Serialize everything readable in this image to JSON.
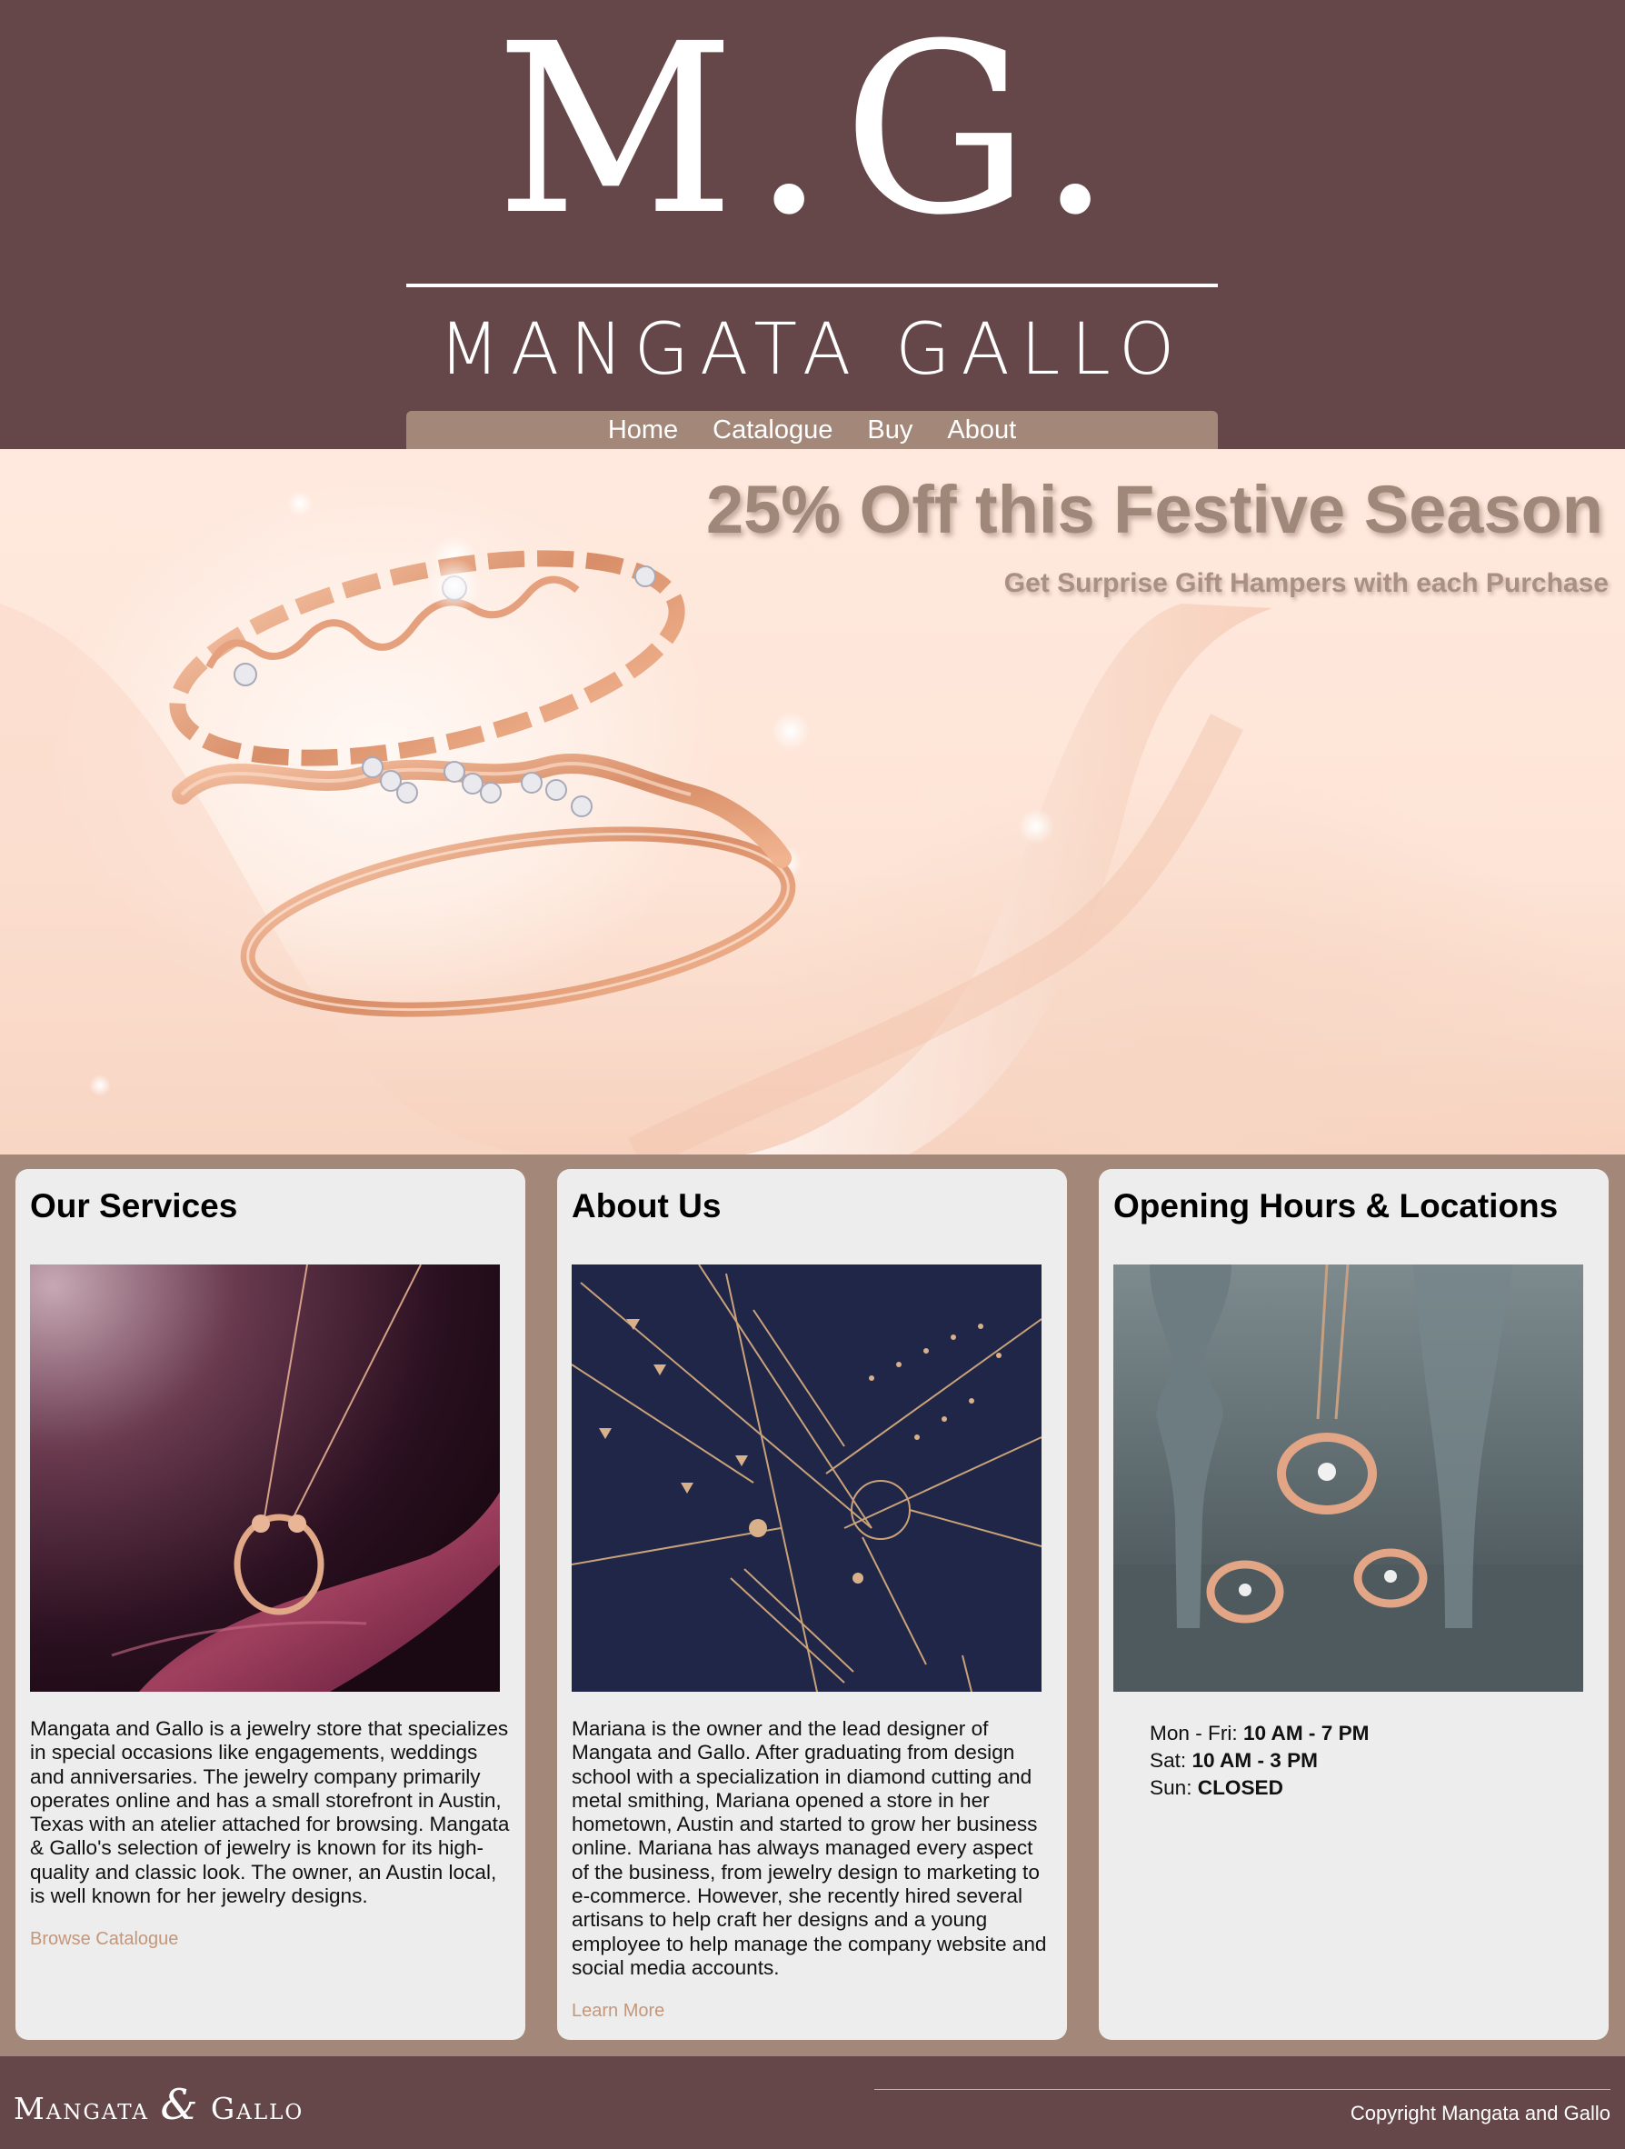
{
  "header": {
    "logo_monogram": "M.G.",
    "logo_name": "MANGATA GALLO",
    "nav": [
      {
        "label": "Home"
      },
      {
        "label": "Catalogue"
      },
      {
        "label": "Buy"
      },
      {
        "label": "About"
      }
    ]
  },
  "hero": {
    "title": "25% Off this Festive Season",
    "subtitle": "Get Surprise Gift Hampers with each Purchase"
  },
  "cards": {
    "services": {
      "title": "Our Services",
      "body": "Mangata and Gallo is a jewelry store that specializes in special occasions like engagements, weddings and anniversaries. The jewelry company primarily operates online and has a small storefront in Austin, Texas with an atelier attached for browsing. Mangata & Gallo's selection of jewelry is known for its high-quality and classic look. The owner, an Austin local, is well known for her jewelry designs.",
      "link": "Browse Catalogue"
    },
    "about": {
      "title": "About Us",
      "body": "Mariana is the owner and the lead designer of Mangata and Gallo. After graduating from design school with a specialization in diamond cutting and metal smithing, Mariana opened a store in her hometown, Austin and started to grow her business online. Mariana has always managed every aspect of the business, from jewelry design to marketing to e-commerce. However, she recently hired several artisans to help craft her designs and a young employee to help manage the company website and social media accounts.",
      "link": "Learn More"
    },
    "hours": {
      "title": "Opening Hours & Locations",
      "rows": [
        {
          "day": "Mon - Fri:",
          "time": "10 AM - 7 PM"
        },
        {
          "day": "Sat:",
          "time": "10 AM - 3 PM"
        },
        {
          "day": "Sun:",
          "time": "CLOSED"
        }
      ]
    }
  },
  "footer": {
    "logo_left": "Mangata",
    "logo_amp": "&",
    "logo_right": "Gallo",
    "copyright": "Copyright Mangata and Gallo"
  },
  "colors": {
    "header_bg": "#654649",
    "accent": "#a3887a",
    "card_bg": "#ededed",
    "link": "#c4977b"
  }
}
